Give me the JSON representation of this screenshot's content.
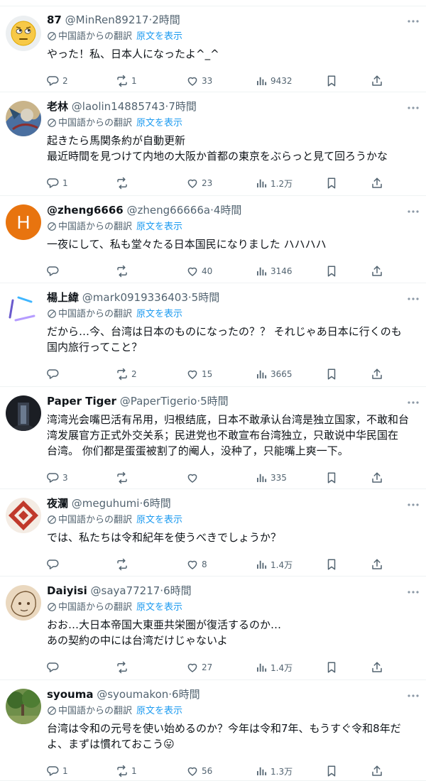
{
  "ui": {
    "translation_label": "中国語からの翻訳",
    "show_original": "原文を表示"
  },
  "tweets": [
    {
      "name": "87",
      "handle": "@MinRen89217",
      "time": "2時間",
      "lines": [
        "やった！私、日本人になったよ^_^"
      ],
      "replies": "2",
      "retweets": "1",
      "likes": "33",
      "views": "9432",
      "avatar": "emoji-face"
    },
    {
      "name": "老林",
      "handle": "@laolin14885743",
      "time": "7時間",
      "lines": [
        "起きたら馬関条約が自動更新",
        "最近時間を見つけて内地の大阪か首都の東京をぶらっと見て回ろうかな"
      ],
      "replies": "1",
      "retweets": "",
      "likes": "23",
      "views": "1.2万",
      "avatar": "painting"
    },
    {
      "name": "@zheng6666",
      "handle": "@zheng66666a",
      "time": "4時間",
      "lines": [
        "一夜にして、私も堂々たる日本国民になりました ハハハハ"
      ],
      "replies": "",
      "retweets": "",
      "likes": "40",
      "views": "3146",
      "avatar": "letter-H",
      "avatar_letter": "H",
      "avatar_color": "#e8740f"
    },
    {
      "name": "楊上緯",
      "handle": "@mark0919336403",
      "time": "5時間",
      "lines": [
        "だから…今、台湾は日本のものになったの？？ それじゃあ日本に行くのも",
        "国内旅行ってこと？"
      ],
      "replies": "",
      "retweets": "2",
      "likes": "15",
      "views": "3665",
      "avatar": "neon-logo"
    },
    {
      "name": "Paper Tiger",
      "handle": "@PaperTigerio",
      "time": "5時間",
      "lines": [
        "湾湾光会嘴巴活有吊用，归根结底，日本不敢承认台湾是独立国家，不敢和台",
        "湾发展官方正式外交关系；民进党也不敢宣布台湾独立，只敢说中华民国在",
        "台湾。 你们都是蛋蛋被割了的阉人，没种了，只能嘴上爽一下。"
      ],
      "replies": "3",
      "retweets": "",
      "likes": "",
      "views": "335",
      "avatar": "dark-hall",
      "no_translation": true
    },
    {
      "name": "夜瀾",
      "handle": "@meguhumi",
      "time": "6時間",
      "lines": [
        "では、私たちは令和紀年を使うべきでしょうか？"
      ],
      "replies": "",
      "retweets": "",
      "likes": "8",
      "views": "1.4万",
      "avatar": "red-pattern"
    },
    {
      "name": "Daiyisi",
      "handle": "@saya77217",
      "time": "6時間",
      "lines": [
        "おお…大日本帝国大東亜共栄圏が復活するのか…",
        "あの契約の中には台湾だけじゃないよ"
      ],
      "replies": "",
      "retweets": "",
      "likes": "27",
      "views": "1.4万",
      "avatar": "sketch"
    },
    {
      "name": "syouma",
      "handle": "@syoumakon",
      "time": "6時間",
      "lines": [
        "台湾は令和の元号を使い始めるのか？今年は令和7年、もうすぐ令和8年だ",
        "よ、まずは慣れておこう😛"
      ],
      "replies": "1",
      "retweets": "1",
      "likes": "56",
      "views": "1.3万",
      "avatar": "forest"
    }
  ]
}
